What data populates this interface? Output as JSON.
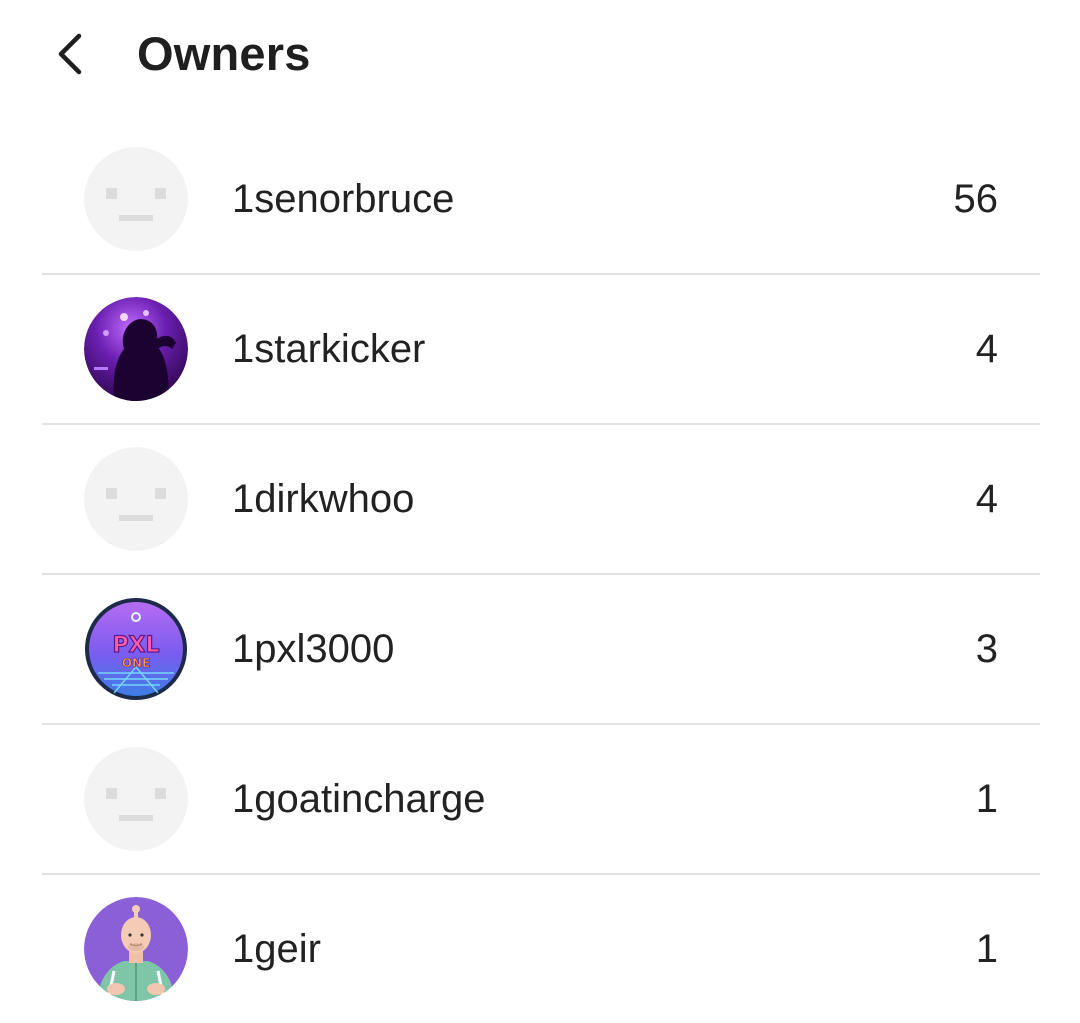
{
  "header": {
    "title": "Owners",
    "back_icon": "chevron-left-icon"
  },
  "owners": [
    {
      "name": "1senorbruce",
      "count": "56",
      "avatar": "placeholder-face"
    },
    {
      "name": "1starkicker",
      "count": "4",
      "avatar": "purple-concert-photo"
    },
    {
      "name": "1dirkwhoo",
      "count": "4",
      "avatar": "placeholder-face"
    },
    {
      "name": "1pxl3000",
      "count": "3",
      "avatar": "pxl-one-logo",
      "avatar_text": [
        "PXL",
        "ONE"
      ]
    },
    {
      "name": "1goatincharge",
      "count": "1",
      "avatar": "placeholder-face"
    },
    {
      "name": "1geir",
      "count": "1",
      "avatar": "bald-man-illustration"
    }
  ],
  "colors": {
    "divider": "#e2e2e2",
    "placeholder_bg": "#f3f3f3",
    "placeholder_mark": "#dcdcdc",
    "purple_avatar": "#4a0e7a",
    "pxl_bg": "#8f63e8",
    "geir_bg": "#8b5fd6"
  }
}
